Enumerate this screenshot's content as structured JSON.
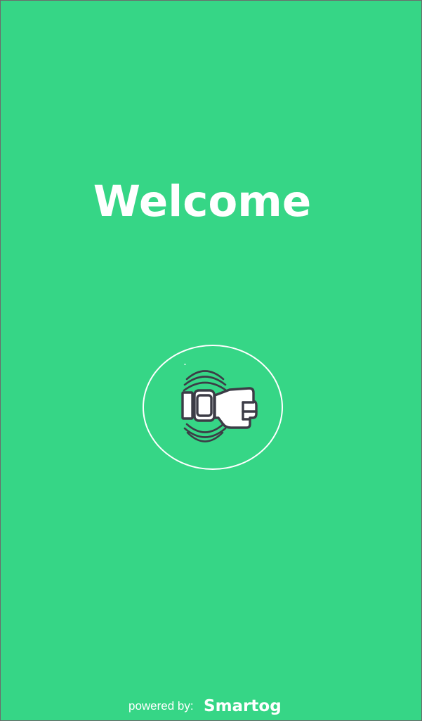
{
  "welcome": {
    "title": "Welcome"
  },
  "tap_area": {
    "icon": "wrist-tap-icon"
  },
  "footer": {
    "powered_label": "powered by:",
    "brand": "Smartog"
  },
  "colors": {
    "background": "#36d686",
    "text": "#ffffff",
    "icon_stroke": "#3c3c46",
    "logo_blue": "#2f7fe0",
    "logo_yellow": "#f2c200"
  }
}
